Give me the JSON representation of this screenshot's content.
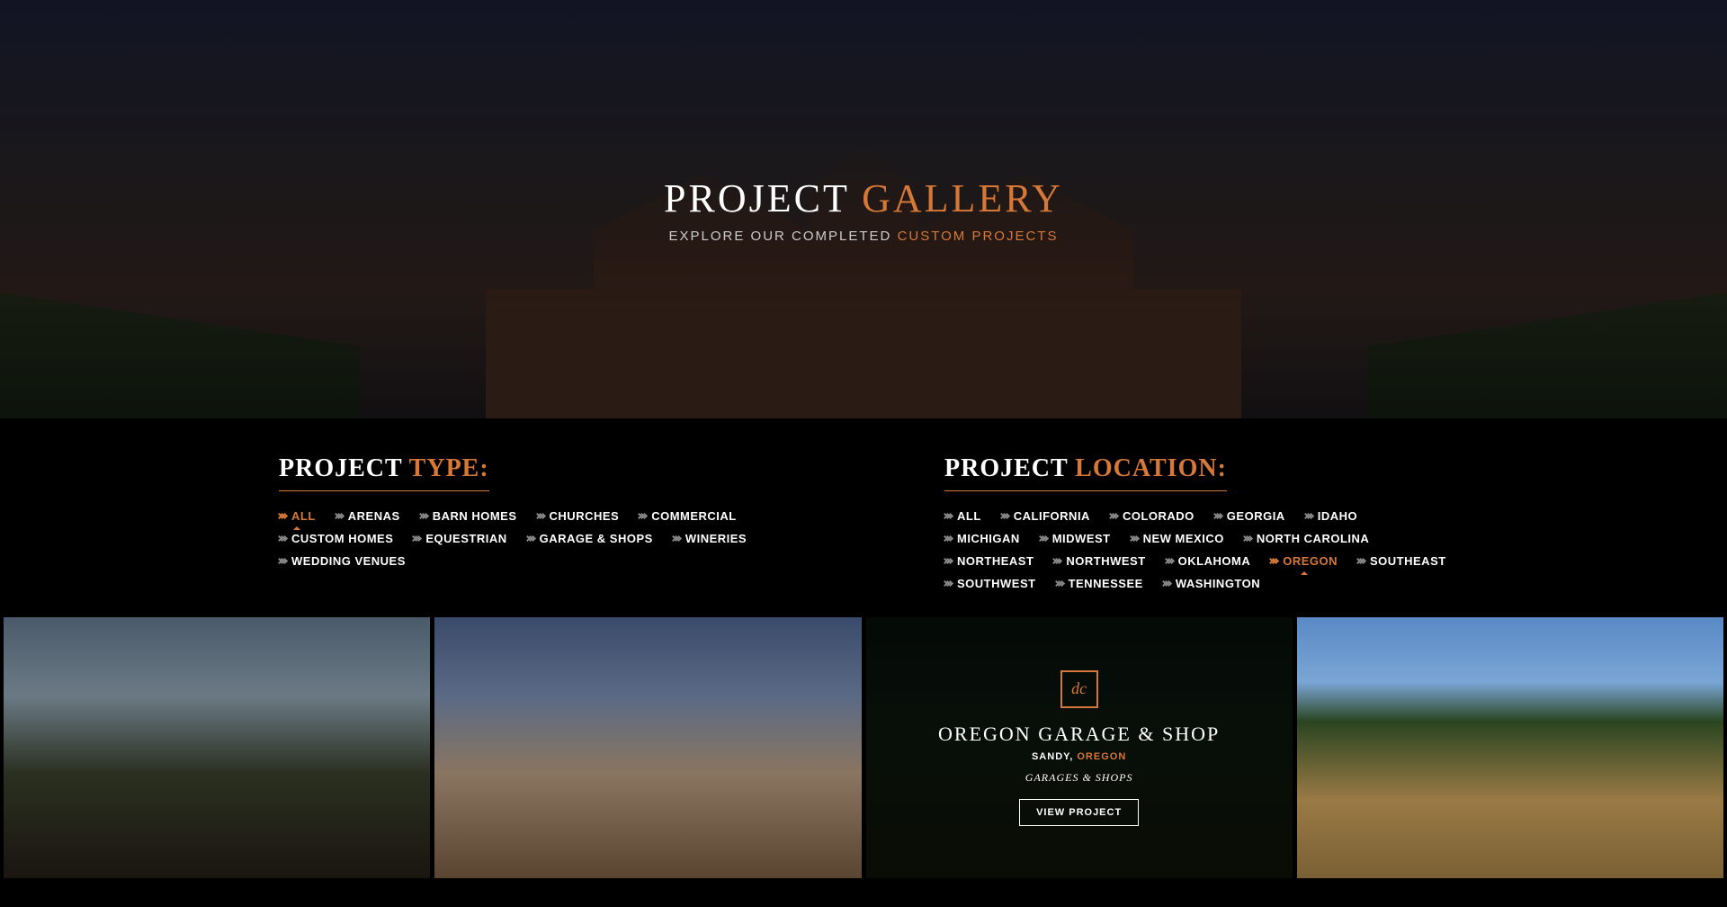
{
  "hero": {
    "title_a": "PROJECT ",
    "title_b": "GALLERY",
    "subtitle_a": "EXPLORE OUR COMPLETED ",
    "subtitle_b": "CUSTOM PROJECTS"
  },
  "filters": {
    "type": {
      "label_a": "PROJECT ",
      "label_b": "TYPE:",
      "items": [
        "ALL",
        "ARENAS",
        "BARN HOMES",
        "CHURCHES",
        "COMMERCIAL",
        "CUSTOM HOMES",
        "EQUESTRIAN",
        "GARAGE & SHOPS",
        "WINERIES",
        "WEDDING VENUES"
      ],
      "active": "ALL"
    },
    "location": {
      "label_a": "PROJECT ",
      "label_b": "LOCATION:",
      "items": [
        "ALL",
        "CALIFORNIA",
        "COLORADO",
        "GEORGIA",
        "IDAHO",
        "MICHIGAN",
        "MIDWEST",
        "NEW MEXICO",
        "NORTH CAROLINA",
        "NORTHEAST",
        "NORTHWEST",
        "OKLAHOMA",
        "OREGON",
        "SOUTHEAST",
        "SOUTHWEST",
        "TENNESSEE",
        "WASHINGTON"
      ],
      "active": "OREGON"
    }
  },
  "hover_card": {
    "logo_text": "dc",
    "title": "OREGON GARAGE & SHOP",
    "city": "SANDY, ",
    "state": "OREGON",
    "category": "GARAGES & SHOPS",
    "button": "VIEW PROJECT"
  }
}
